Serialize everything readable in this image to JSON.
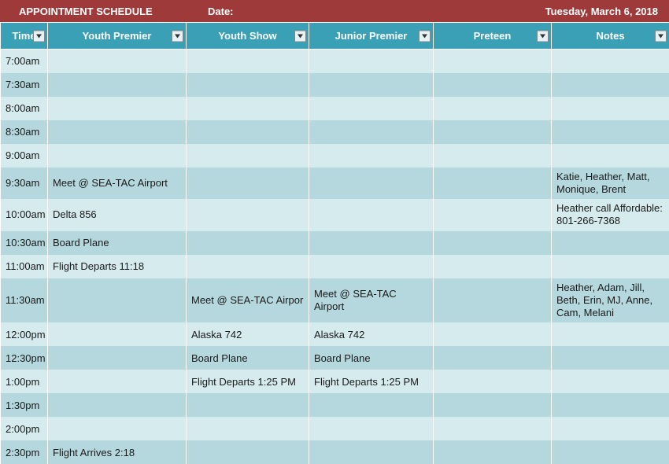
{
  "header": {
    "title": "APPOINTMENT SCHEDULE",
    "date_label": "Date:",
    "date_value": "Tuesday, March 6, 2018"
  },
  "columns": {
    "time": "Time",
    "youth_premier": "Youth Premier",
    "youth_show": "Youth Show",
    "junior_premier": "Junior Premier",
    "preteen": "Preteen",
    "notes": "Notes"
  },
  "rows": [
    {
      "time": "7:00am",
      "yp": "",
      "ys": "",
      "jp": "",
      "pt": "",
      "nt": "",
      "tall": false
    },
    {
      "time": "7:30am",
      "yp": "",
      "ys": "",
      "jp": "",
      "pt": "",
      "nt": "",
      "tall": false
    },
    {
      "time": "8:00am",
      "yp": "",
      "ys": "",
      "jp": "",
      "pt": "",
      "nt": "",
      "tall": false
    },
    {
      "time": "8:30am",
      "yp": "",
      "ys": "",
      "jp": "",
      "pt": "",
      "nt": "",
      "tall": false
    },
    {
      "time": "9:00am",
      "yp": "",
      "ys": "",
      "jp": "",
      "pt": "",
      "nt": "",
      "tall": false
    },
    {
      "time": "9:30am",
      "yp": "Meet @ SEA-TAC Airport",
      "ys": "",
      "jp": "",
      "pt": "",
      "nt": "Katie, Heather, Matt, Monique, Brent",
      "tall": true
    },
    {
      "time": "10:00am",
      "yp": "Delta 856",
      "ys": "",
      "jp": "",
      "pt": "",
      "nt": "Heather call Affordable:  801-266-7368",
      "tall": true
    },
    {
      "time": "10:30am",
      "yp": "Board Plane",
      "ys": "",
      "jp": "",
      "pt": "",
      "nt": "",
      "tall": false
    },
    {
      "time": "11:00am",
      "yp": "Flight Departs 11:18",
      "ys": "",
      "jp": "",
      "pt": "",
      "nt": "",
      "tall": false
    },
    {
      "time": "11:30am",
      "yp": "",
      "ys": "Meet @ SEA-TAC Airpor",
      "jp": "Meet @ SEA-TAC Airport",
      "pt": "",
      "nt": "Heather, Adam, Jill, Beth, Erin, MJ, Anne, Cam, Melani",
      "tall": true
    },
    {
      "time": "12:00pm",
      "yp": "",
      "ys": "Alaska 742",
      "jp": "Alaska 742",
      "pt": "",
      "nt": "",
      "tall": false
    },
    {
      "time": "12:30pm",
      "yp": "",
      "ys": "Board Plane",
      "jp": "Board Plane",
      "pt": "",
      "nt": "",
      "tall": false
    },
    {
      "time": "1:00pm",
      "yp": "",
      "ys": "Flight Departs 1:25 PM",
      "jp": "Flight Departs 1:25 PM",
      "pt": "",
      "nt": "",
      "tall": false
    },
    {
      "time": "1:30pm",
      "yp": "",
      "ys": "",
      "jp": "",
      "pt": "",
      "nt": "",
      "tall": false
    },
    {
      "time": "2:00pm",
      "yp": "",
      "ys": "",
      "jp": "",
      "pt": "",
      "nt": "",
      "tall": false
    },
    {
      "time": "2:30pm",
      "yp": "Flight Arrives 2:18",
      "ys": "",
      "jp": "",
      "pt": "",
      "nt": "",
      "tall": false
    }
  ]
}
